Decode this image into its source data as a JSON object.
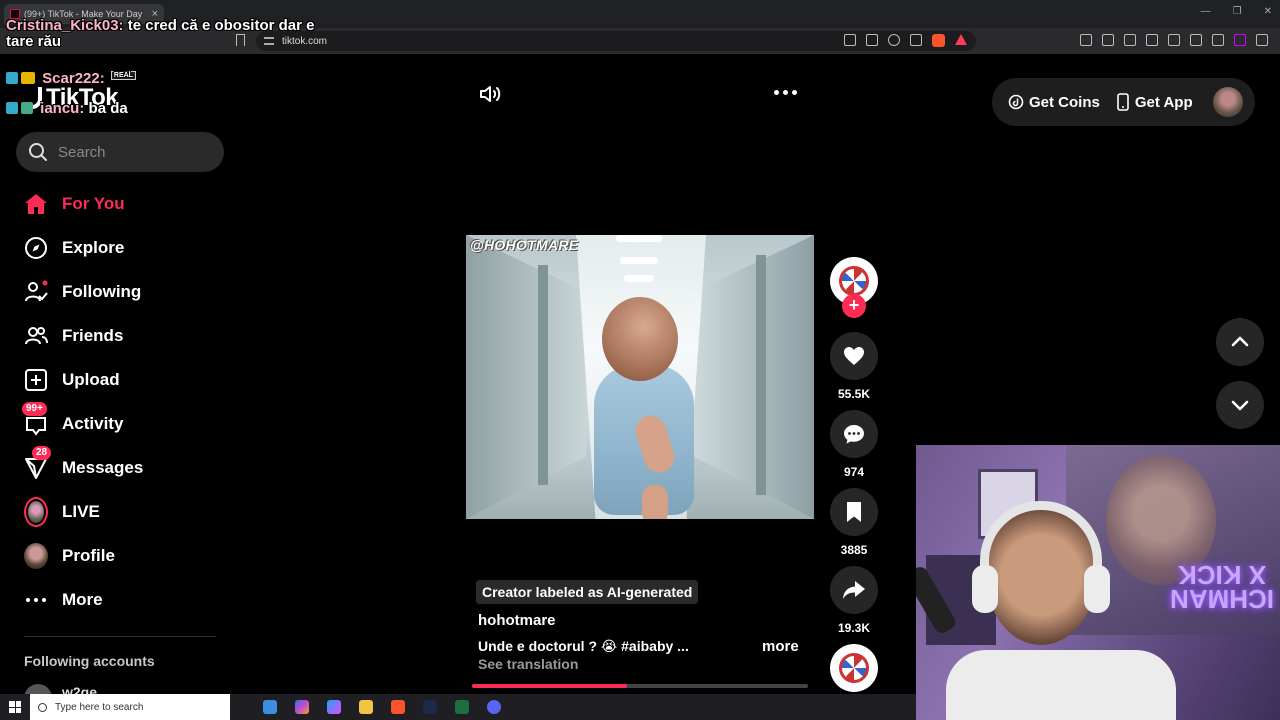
{
  "browser": {
    "tab_title": "(99+) TikTok - Make Your Day",
    "tab_close": "×",
    "url": "tiktok.com"
  },
  "chat": [
    {
      "user": "Cristina_Kick03:",
      "message": "te cred că e obositor dar e tare rău"
    },
    {
      "user": "Scar222:",
      "message": "",
      "badge": "REAL"
    },
    {
      "user": "iancu:",
      "message": "ba da"
    }
  ],
  "logo": {
    "text": "TikTok"
  },
  "search": {
    "placeholder": "Search"
  },
  "sidebar": {
    "items": [
      {
        "label": "For You",
        "icon": "home-icon",
        "active": true
      },
      {
        "label": "Explore",
        "icon": "compass-icon"
      },
      {
        "label": "Following",
        "icon": "following-icon"
      },
      {
        "label": "Friends",
        "icon": "friends-icon"
      },
      {
        "label": "Upload",
        "icon": "upload-icon"
      },
      {
        "label": "Activity",
        "icon": "inbox-icon",
        "badge": "99+"
      },
      {
        "label": "Messages",
        "icon": "send-icon",
        "badge": "28"
      },
      {
        "label": "LIVE",
        "icon": "live-avatar-icon"
      },
      {
        "label": "Profile",
        "icon": "profile-avatar-icon"
      },
      {
        "label": "More",
        "icon": "more-dots-icon"
      }
    ],
    "following_title": "Following accounts",
    "following_accounts": [
      {
        "name": "w2ge"
      }
    ]
  },
  "player": {
    "watermark": "@HOHOTMARE",
    "ai_label": "Creator labeled as AI-generated",
    "author": "hohotmare",
    "caption": "Unde e doctorul ? 😭 #aibaby  ...",
    "more": "more",
    "see_translation": "See translation",
    "progress": 0.46
  },
  "actions": {
    "likes": "55.5K",
    "comments": "974",
    "saves": "3885",
    "shares": "19.3K"
  },
  "topbar": {
    "get_coins": "Get Coins",
    "get_app": "Get App"
  },
  "webcam": {
    "neon_text": "ICHMAN X KICK"
  },
  "taskbar": {
    "search_placeholder": "Type here to search"
  },
  "colors": {
    "accent": "#fe2c55",
    "background": "#000000",
    "panel": "#262626"
  }
}
